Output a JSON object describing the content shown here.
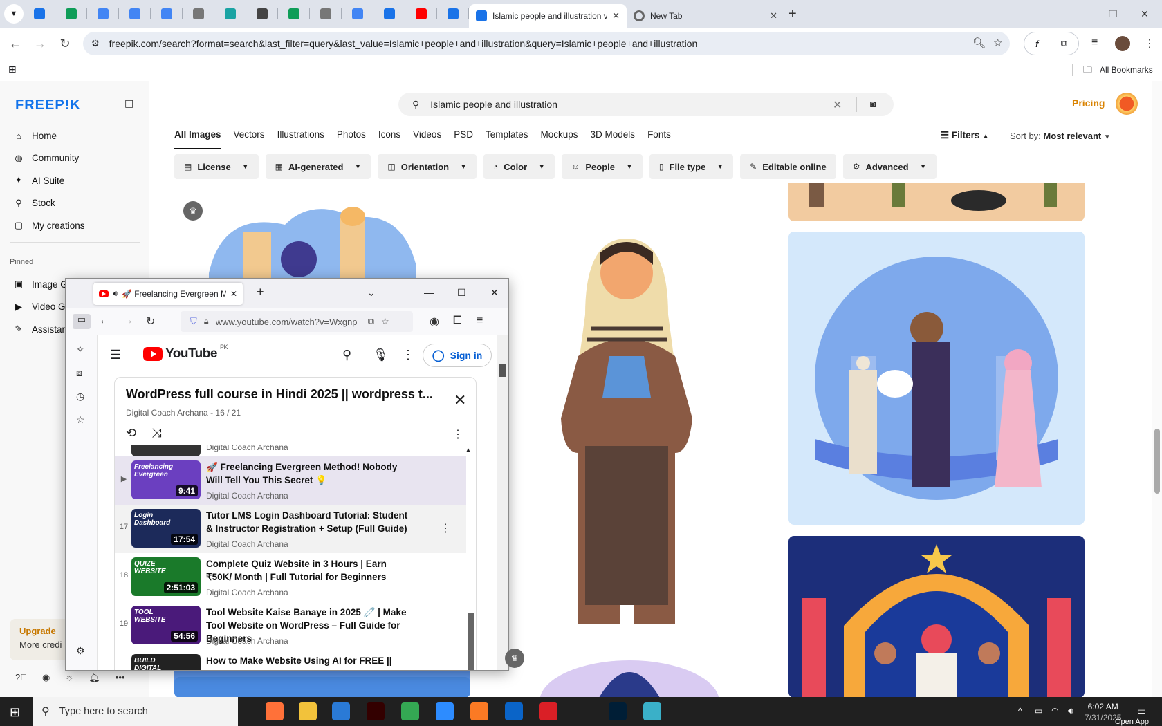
{
  "chrome": {
    "tabs": [
      {
        "title": "Islamic people and illustration v",
        "active": true
      },
      {
        "title": "New Tab",
        "active": false
      }
    ],
    "pinned_tab_colors": [
      "#1a73e8",
      "#0f9d58",
      "#4285f4",
      "#4285f4",
      "#4285f4",
      "#777777",
      "#1aa3a3",
      "#444444",
      "#0f9d58",
      "#777777",
      "#4285f4",
      "#1a73e8",
      "#ff0000",
      "#1a73e8"
    ],
    "url": "freepik.com/search?format=search&last_filter=query&last_value=Islamic+people+and+illustration&query=Islamic+people+and+illustration",
    "bookmarks_label": "All Bookmarks"
  },
  "freepik": {
    "logo": "FREEP!K",
    "nav": [
      {
        "icon": "home-icon",
        "label": "Home"
      },
      {
        "icon": "globe-icon",
        "label": "Community"
      },
      {
        "icon": "sparkle-icon",
        "label": "AI Suite"
      },
      {
        "icon": "search-icon",
        "label": "Stock"
      },
      {
        "icon": "folder-icon",
        "label": "My creations"
      }
    ],
    "pinned_label": "Pinned",
    "pinned": [
      {
        "icon": "image-icon",
        "label": "Image G"
      },
      {
        "icon": "video-icon",
        "label": "Video G"
      },
      {
        "icon": "assistant-icon",
        "label": "Assistan"
      }
    ],
    "upgrade": {
      "title": "Upgrade",
      "subtitle": "More credi"
    },
    "search_value": "Islamic people and illustration",
    "pricing": "Pricing",
    "tabs": [
      "All Images",
      "Vectors",
      "Illustrations",
      "Photos",
      "Icons",
      "Videos",
      "PSD",
      "Templates",
      "Mockups",
      "3D Models",
      "Fonts"
    ],
    "filters_label": "Filters",
    "sort_label": "Sort by:",
    "sort_value": "Most relevant",
    "chips": [
      {
        "icon": "license-icon",
        "label": "License",
        "dropdown": true
      },
      {
        "icon": "ai-icon",
        "label": "AI-generated",
        "dropdown": true
      },
      {
        "icon": "orientation-icon",
        "label": "Orientation",
        "dropdown": true
      },
      {
        "icon": "palette-icon",
        "label": "Color",
        "dropdown": true
      },
      {
        "icon": "people-icon",
        "label": "People",
        "dropdown": true
      },
      {
        "icon": "file-icon",
        "label": "File type",
        "dropdown": true
      },
      {
        "icon": "pen-icon",
        "label": "Editable online",
        "dropdown": false
      },
      {
        "icon": "gear-icon",
        "label": "Advanced",
        "dropdown": true
      }
    ]
  },
  "firefox": {
    "tab_title": "🚀 Freelancing Evergreen M",
    "url": "www.youtube.com/watch?v=Wxgnp"
  },
  "youtube": {
    "region": "PK",
    "sign_in": "Sign in",
    "playlist_title": "WordPress full course in Hindi 2025 || wordpress t...",
    "playlist_sub": "Digital Coach Archana - 16 / 21",
    "prev_channel": "Digital Coach Archana",
    "items": [
      {
        "index": "▶",
        "title": "🚀 Freelancing Evergreen Method! Nobody Will Tell You This Secret 💡",
        "channel": "Digital Coach Archana",
        "duration": "9:41",
        "thumb_text": "Freelancing Evergreen",
        "thumb_color": "#6b3fc0",
        "state": "current"
      },
      {
        "index": "17",
        "title": "Tutor LMS Login Dashboard Tutorial: Student & Instructor Registration + Setup (Full Guide)",
        "channel": "Digital Coach Archana",
        "duration": "17:54",
        "thumb_text": "Login Dashboard",
        "thumb_color": "#1c2a5a",
        "state": "hover"
      },
      {
        "index": "18",
        "title": "Complete Quiz Website in 3 Hours | Earn ₹50K/ Month | Full Tutorial for Beginners",
        "channel": "Digital Coach Archana",
        "duration": "2:51:03",
        "thumb_text": "QUIZE WEBSITE",
        "thumb_color": "#1a7a2a",
        "state": "normal"
      },
      {
        "index": "19",
        "title": "Tool Website Kaise Banaye in 2025 🧷 | Make Tool Website on WordPress – Full Guide for Beginners",
        "channel": "Digital Coach Archana",
        "duration": "54:56",
        "thumb_text": "TOOL WEBSITE",
        "thumb_color": "#4a1a7a",
        "state": "normal"
      },
      {
        "index": "",
        "title": "How to Make Website Using AI for FREE ||",
        "channel": "",
        "duration": "",
        "thumb_text": "BUILD DIGITAL",
        "thumb_color": "#222222",
        "state": "normal"
      }
    ]
  },
  "taskbar": {
    "search_placeholder": "Type here to search",
    "time": "6:02 AM",
    "date": "7/31/2025",
    "open_app": "Open App"
  }
}
